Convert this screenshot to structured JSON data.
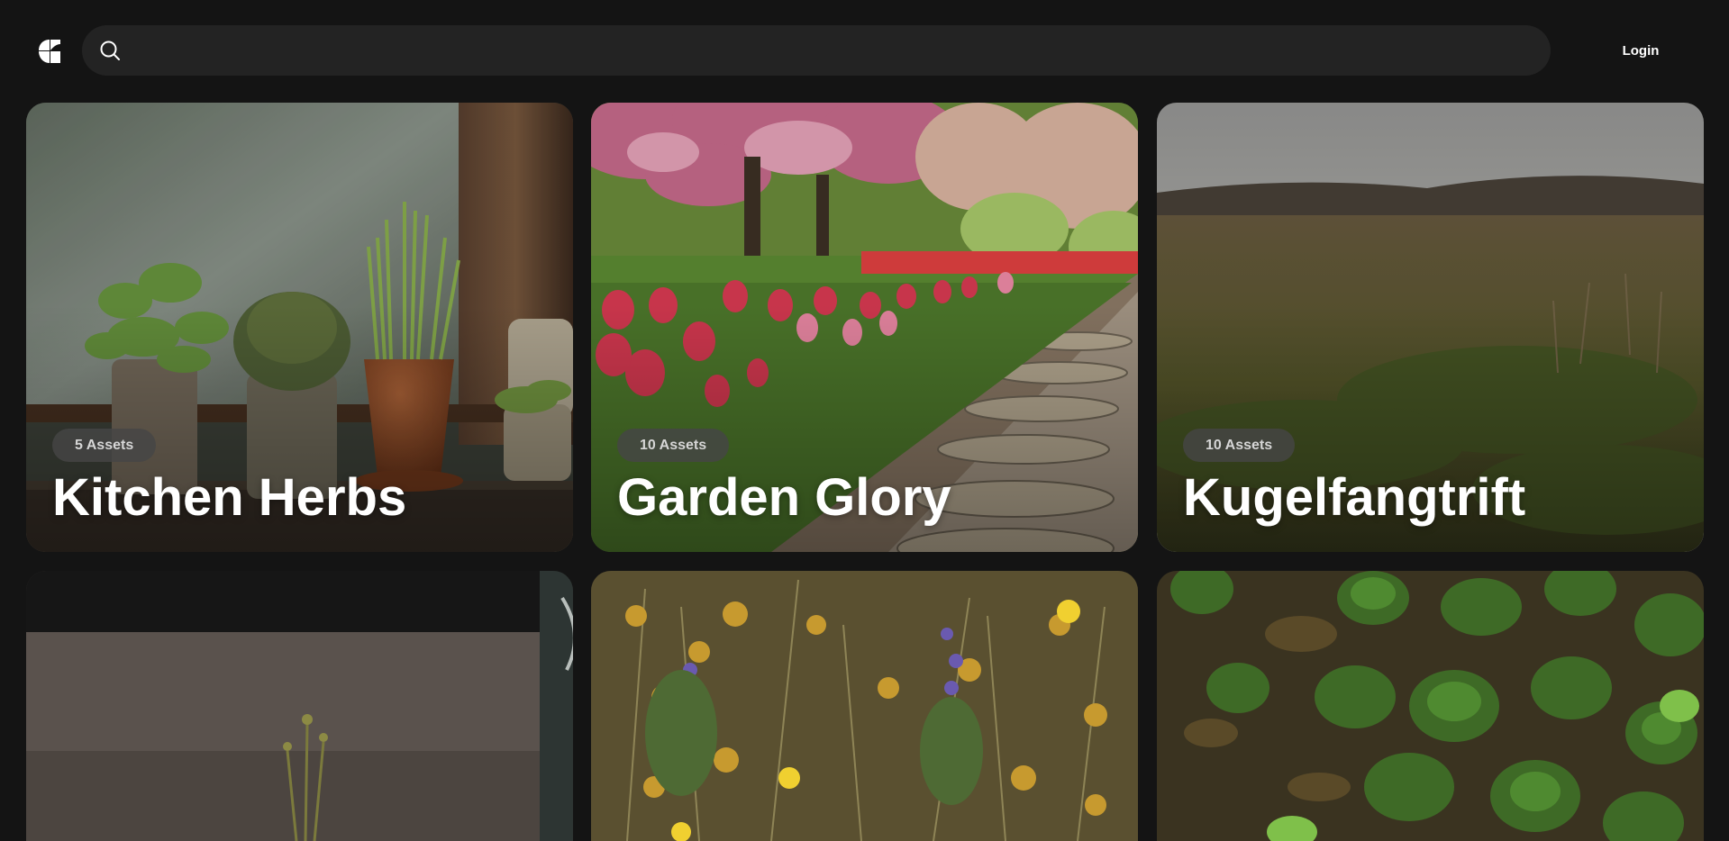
{
  "header": {
    "search_placeholder": "",
    "login_label": "Login"
  },
  "icons": {
    "logo": "logo-icon",
    "search": "search-icon"
  },
  "collections": [
    {
      "title": "Kitchen Herbs",
      "assets": "5 Assets"
    },
    {
      "title": "Garden Glory",
      "assets": "10 Assets"
    },
    {
      "title": "Kugelfangtrift",
      "assets": "10 Assets"
    },
    {
      "title": "",
      "assets": ""
    },
    {
      "title": "",
      "assets": ""
    },
    {
      "title": "",
      "assets": ""
    }
  ],
  "colors": {
    "background": "#141414",
    "search_bg": "#232323",
    "badge_bg": "#464646",
    "text": "#ffffff"
  }
}
